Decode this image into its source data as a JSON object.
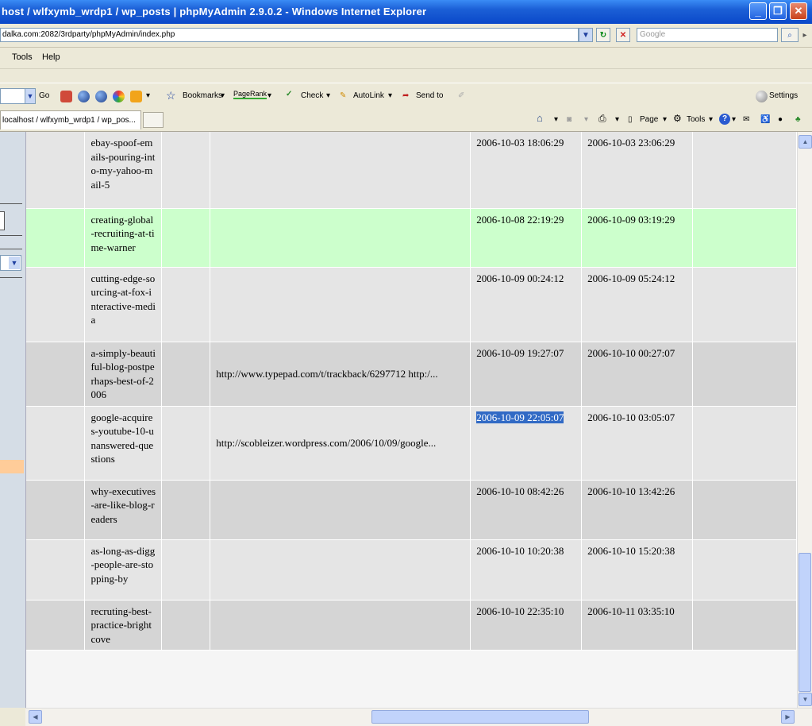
{
  "window": {
    "title": "host / wlfxymb_wrdp1 / wp_posts | phpMyAdmin 2.9.0.2 - Windows Internet Explorer"
  },
  "address": {
    "url": "dalka.com:2082/3rdparty/phpMyAdmin/index.php",
    "search_placeholder": "Google"
  },
  "menu": {
    "items": [
      "Tools",
      "Help"
    ]
  },
  "toolbar": {
    "go": "Go",
    "bookmarks": "Bookmarks",
    "pagerank": "PageRank",
    "check": "Check",
    "autolink": "AutoLink",
    "sendto": "Send to",
    "settings": "Settings"
  },
  "tabs": {
    "active": "localhost / wlfxymb_wrdp1 / wp_pos...",
    "commands": {
      "page": "Page",
      "tools": "Tools"
    }
  },
  "colors": {
    "row_odd": "#e5e5e5",
    "row_even": "#d5d5d5",
    "row_marked": "#ccffcc",
    "selection": "#316ac5"
  },
  "rows": [
    {
      "slug": "ebay-spoof-emails-pouring-into-my-yahoo-mail-5",
      "url": "",
      "date": "2006-10-03 18:06:29",
      "date_gmt": "2006-10-03 23:06:29"
    },
    {
      "slug": "creating-global-recruiting-at-time-warner",
      "url": "",
      "date": "2006-10-08 22:19:29",
      "date_gmt": "2006-10-09 03:19:29"
    },
    {
      "slug": "cutting-edge-sourcing-at-fox-interactive-media",
      "url": "",
      "date": "2006-10-09 00:24:12",
      "date_gmt": "2006-10-09 05:24:12"
    },
    {
      "slug": "a-simply-beautiful-blog-postperhaps-best-of-2006",
      "url": "http://www.typepad.com/t/trackback/6297712 http:/...",
      "date": "2006-10-09 19:27:07",
      "date_gmt": "2006-10-10 00:27:07"
    },
    {
      "slug": "google-acquires-youtube-10-unanswered-questions",
      "url": "http://scobleizer.wordpress.com/2006/10/09/google...",
      "date": "2006-10-09 22:05:07",
      "date_gmt": "2006-10-10 03:05:07"
    },
    {
      "slug": "why-executives-are-like-blog-readers",
      "url": "",
      "date": "2006-10-10 08:42:26",
      "date_gmt": "2006-10-10 13:42:26"
    },
    {
      "slug": "as-long-as-digg-people-are-stopping-by",
      "url": "",
      "date": "2006-10-10 10:20:38",
      "date_gmt": "2006-10-10 15:20:38"
    },
    {
      "slug": "recruting-best-practice-brightcove",
      "url": "",
      "date": "2006-10-10 22:35:10",
      "date_gmt": "2006-10-11 03:35:10"
    }
  ]
}
